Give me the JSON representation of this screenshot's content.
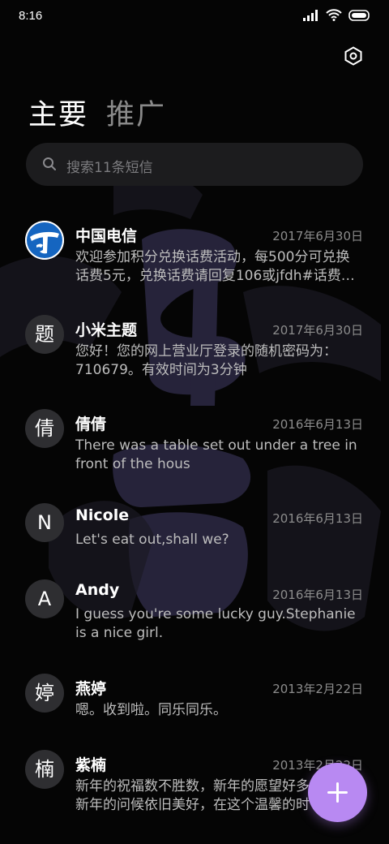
{
  "status": {
    "time": "8:16"
  },
  "tabs": [
    {
      "label": "主要",
      "active": true
    },
    {
      "label": "推广",
      "active": false
    }
  ],
  "search": {
    "placeholder": "搜索11条短信"
  },
  "conversations": [
    {
      "name": "中国电信",
      "date": "2017年6月30日",
      "avatar": "",
      "avatar_icon": "china-telecom-logo-icon",
      "preview": "欢迎参加积分兑换话费活动，每500分可兑换\n话费5元，兑换话费请回复106或jfdh#话费…"
    },
    {
      "name": "小米主题",
      "date": "2017年6月30日",
      "avatar": "题",
      "preview": "您好！您的网上营业厅登录的随机密码为：\n710679。有效时间为3分钟"
    },
    {
      "name": "倩倩",
      "date": "2016年6月13日",
      "avatar": "倩",
      "preview": "There was a table set out under a tree in\nfront of the hous"
    },
    {
      "name": "Nicole",
      "date": "2016年6月13日",
      "avatar": "N",
      "preview": "Let's eat out,shall we?"
    },
    {
      "name": "Andy",
      "date": "2016年6月13日",
      "avatar": "A",
      "preview": "I guess you're some lucky guy.Stephanie\nis a nice girl."
    },
    {
      "name": "燕婷",
      "date": "2013年2月22日",
      "avatar": "婷",
      "preview": "嗯。收到啦。同乐同乐。"
    },
    {
      "name": "紫楠",
      "date": "2013年2月22日",
      "avatar": "楠",
      "preview": "新年的祝福数不胜数，新年的愿望好多\n新年的问候依旧美好，在这个温馨的时"
    }
  ],
  "colors": {
    "accent": "#b889f2",
    "background": "#050505",
    "search_bg": "#1c1c1e"
  }
}
